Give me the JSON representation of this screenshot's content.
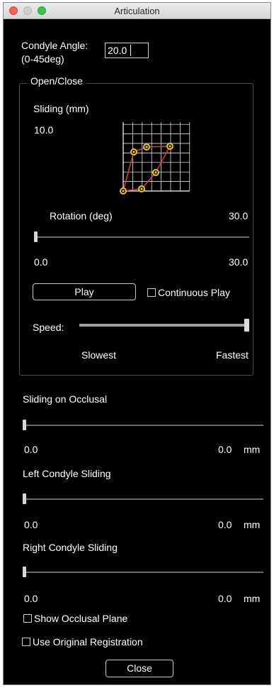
{
  "window": {
    "title": "Articulation"
  },
  "condyle_angle": {
    "label_line1": "Condyle Angle:",
    "label_line2": "(0-45deg)",
    "value": "20.0"
  },
  "open_close": {
    "group_label": "Open/Close",
    "sliding_label": "Sliding (mm)",
    "sliding_value": "10.0",
    "rotation_label": "Rotation (deg)",
    "rotation_max_top": "30.0",
    "rotation_slider": {
      "min_label": "0.0",
      "max_label": "30.0",
      "fraction": 0.0
    },
    "play_button": "Play",
    "continuous_play": {
      "label": "Continuous Play",
      "checked": false
    },
    "speed": {
      "label": "Speed:",
      "slowest": "Slowest",
      "fastest": "Fastest",
      "fraction": 1.0
    }
  },
  "sliding_on_occlusal": {
    "label": "Sliding on Occlusal",
    "min_label": "0.0",
    "value_label": "0.0",
    "unit": "mm",
    "fraction": 0.0
  },
  "left_condyle_sliding": {
    "label": "Left Condyle Sliding",
    "min_label": "0.0",
    "value_label": "0.0",
    "unit": "mm",
    "fraction": 0.0
  },
  "right_condyle_sliding": {
    "label": "Right Condyle Sliding",
    "min_label": "0.0",
    "value_label": "0.0",
    "unit": "mm",
    "fraction": 0.0
  },
  "show_occlusal_plane": {
    "label": "Show Occlusal Plane",
    "checked": false
  },
  "use_original_registration": {
    "label": "Use Original Registration",
    "checked": false
  },
  "close_button": "Close",
  "colors": {
    "window_bg": "#000000",
    "text": "#ffffff",
    "curve": "#e03a3a",
    "point_fill": "#f0c419",
    "grid": "#ffffff"
  }
}
